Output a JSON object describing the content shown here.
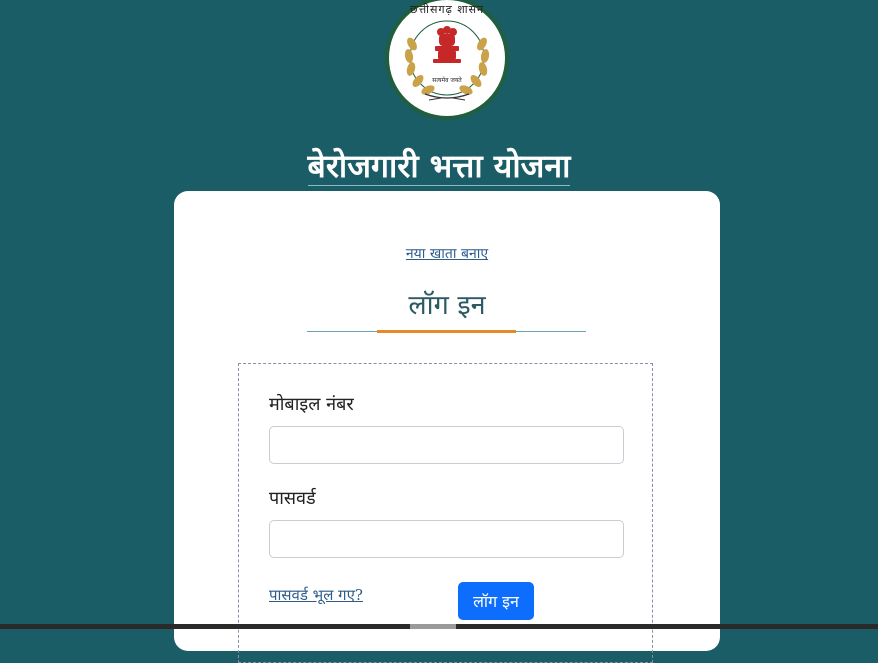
{
  "header": {
    "emblem_top_text": "छत्तीसगढ़ शासन",
    "emblem_motto": "सत्यमेव जयते",
    "title": "बेरोजगारी भत्ता योजना"
  },
  "card": {
    "signup_link": "नया खाता बनाए",
    "heading": "लॉग इन"
  },
  "form": {
    "mobile_label": "मोबाइल नंबर",
    "mobile_value": "",
    "password_label": "पासवर्ड",
    "password_value": "",
    "forgot_link": "पासवर्ड भूल गए?",
    "login_button": "लॉग इन"
  },
  "colors": {
    "background": "#1b5d66",
    "accent": "#e58a26",
    "button": "#0d6efd",
    "link": "#2d5b8c"
  },
  "icons": {
    "emblem": "state-emblem-icon"
  }
}
